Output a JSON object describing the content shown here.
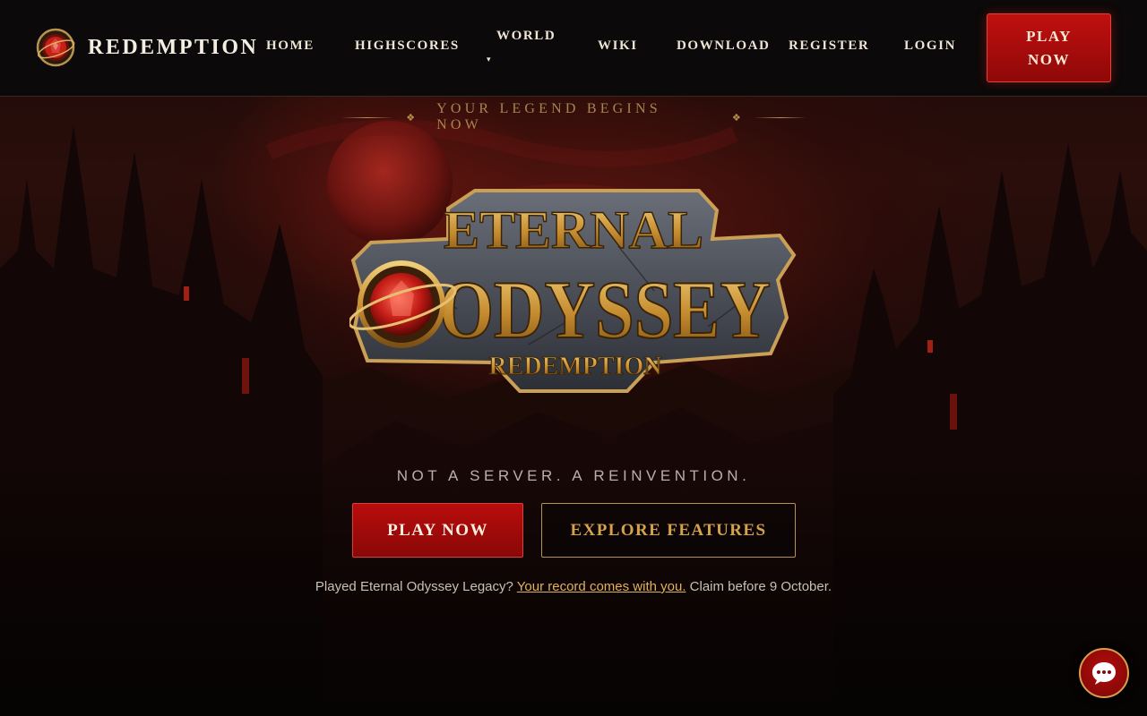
{
  "brand": {
    "name": "REDEMPTION",
    "emblem_icon": "redemption-gem-emblem-icon"
  },
  "nav": {
    "home": "HOME",
    "highscores": "HIGHSCORES",
    "world": "WORLD",
    "world_caret": "▾",
    "wiki": "WIKI",
    "download": "DOWNLOAD",
    "register": "REGISTER",
    "login": "LOGIN",
    "play_now_line1": "PLAY",
    "play_now_line2": "NOW"
  },
  "hero": {
    "eyebrow": "YOUR LEGEND BEGINS NOW",
    "eyebrow_ornament": "❖",
    "logo": {
      "line1": "ETERNAL",
      "line2": "ODYSSEY",
      "line3": "REDEMPTION"
    },
    "tagline": "NOT A SERVER. A REINVENTION.",
    "primary_cta": "PLAY NOW",
    "secondary_cta": "EXPLORE FEATURES",
    "legacy_prefix": "Played Eternal Odyssey Legacy?",
    "legacy_link": "Your record comes with you.",
    "legacy_suffix": "Claim before 9 October."
  },
  "chat": {
    "icon": "chat-bubble-icon"
  },
  "colors": {
    "accent_red": "#b80d0c",
    "gold": "#d4a34a",
    "header_bg": "#0b0909"
  }
}
